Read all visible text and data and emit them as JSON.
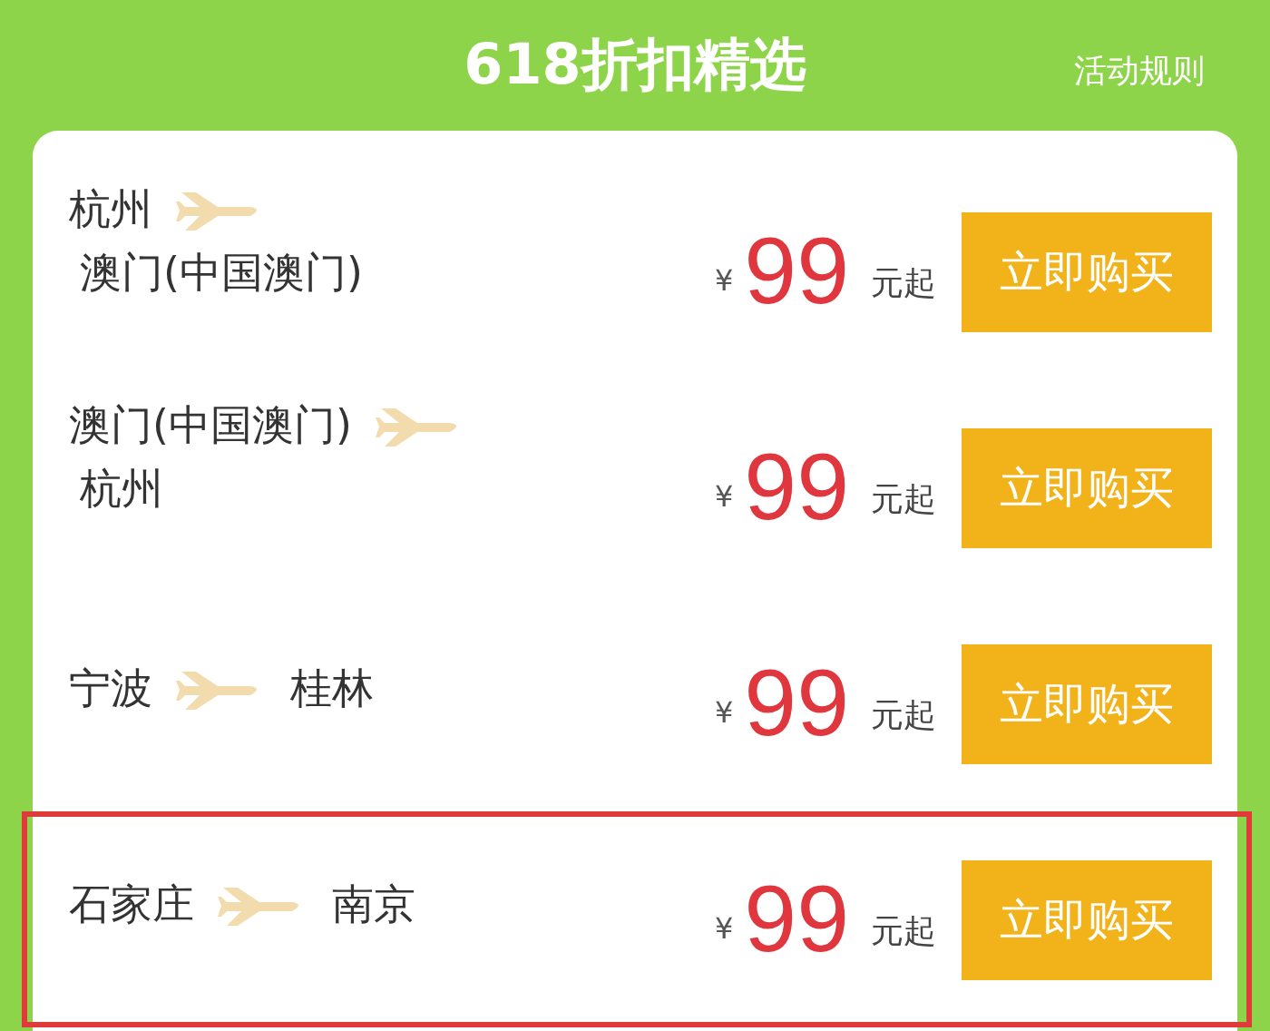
{
  "header": {
    "title": "618折扣精选",
    "rules_link": "活动规则"
  },
  "deals": [
    {
      "kind": "two_line",
      "origin": "杭州",
      "destination": "澳门(中国澳门)",
      "currency": "¥",
      "price": "99",
      "suffix": "元起",
      "button": "立即购买",
      "highlighted": false
    },
    {
      "kind": "two_line",
      "origin": "澳门(中国澳门)",
      "destination": "杭州",
      "currency": "¥",
      "price": "99",
      "suffix": "元起",
      "button": "立即购买",
      "highlighted": false
    },
    {
      "kind": "one_line",
      "origin": "宁波",
      "destination": "桂林",
      "currency": "¥",
      "price": "99",
      "suffix": "元起",
      "button": "立即购买",
      "highlighted": false
    },
    {
      "kind": "one_line",
      "origin": "石家庄",
      "destination": "南京",
      "currency": "¥",
      "price": "99",
      "suffix": "元起",
      "button": "立即购买",
      "highlighted": true
    }
  ]
}
